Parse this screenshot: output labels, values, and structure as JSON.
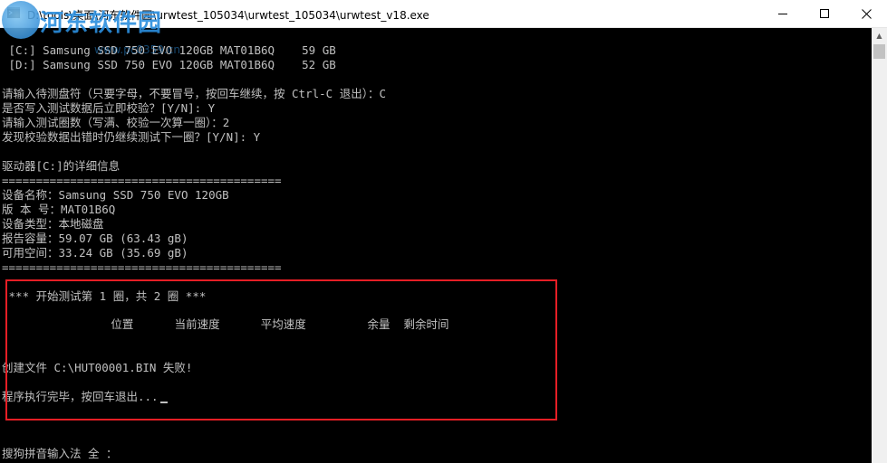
{
  "window": {
    "title": "D:\\tools\\桌面\\河东软件园\\urwtest_105034\\urwtest_105034\\urwtest_v18.exe"
  },
  "watermark": {
    "brand": "河东软件园",
    "url": "www.pc0359.cn"
  },
  "console_lines": [
    " [C:] Samsung SSD 750 EVO 120GB MAT01B6Q    59 GB",
    " [D:] Samsung SSD 750 EVO 120GB MAT01B6Q    52 GB",
    "",
    "请输入待测盘符（只要字母，不要冒号，按回车继续，按 Ctrl-C 退出）：C",
    "是否写入测试数据后立即校验？[Y/N]: Y",
    "请输入测试圈数（写满、校验一次算一圈）：2",
    "发现校验数据出错时仍继续测试下一圈？[Y/N]: Y",
    "",
    "驱动器[C:]的详细信息",
    "=========================================",
    "设备名称：Samsung SSD 750 EVO 120GB",
    "版 本 号：MAT01B6Q",
    "设备类型：本地磁盘",
    "报告容量：59.07 GB (63.43 gB)",
    "可用空间：33.24 GB (35.69 gB)",
    "========================================="
  ],
  "test_block": {
    "header": " *** 开始测试第 1 圈，共 2 圈 ***",
    "columns": "                位置      当前速度      平均速度         余量  剩余时间",
    "error": "创建文件 C:\\HUT00001.BIN 失败!",
    "finish": "程序执行完毕，按回车退出..."
  },
  "ime_status": "搜狗拼音输入法 全 ："
}
